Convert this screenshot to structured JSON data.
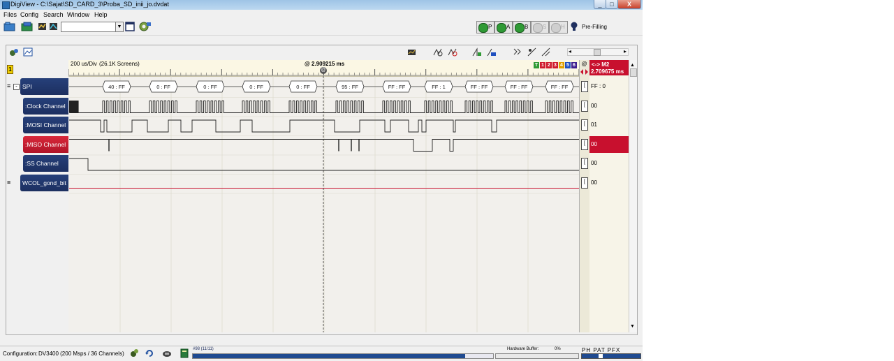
{
  "window": {
    "title": "DigiView - C:\\Sajat\\SD_CARD_3\\Proba_SD_inii_jo.dvdat",
    "min": "_",
    "max": "□",
    "close": "X"
  },
  "menu": [
    "Files",
    "Config",
    "Search",
    "Window",
    "Help"
  ],
  "toolbar": {
    "combo_value": "",
    "buttons": [
      {
        "key": "P",
        "label": "P"
      },
      {
        "key": "A",
        "label": "A"
      },
      {
        "key": "B",
        "label": "B"
      },
      {
        "key": "S",
        "label": "S"
      },
      {
        "key": "H",
        "label": "H"
      }
    ],
    "status": "Pre-Filling"
  },
  "marker_toolbar": {
    "trigger_badge": "1",
    "hscroll_left": "◂",
    "hscroll_right": "▸"
  },
  "ruler": {
    "timebase": "200 us/Div",
    "screens": "(26.1K Screens)",
    "cursor_time": "@ 2.909215 ms",
    "cursor_marker": "@",
    "legend": [
      "T",
      "1",
      "2",
      "3",
      "4",
      "5",
      "6"
    ],
    "legend_colors": [
      "#2f9a35",
      "#d01c2c",
      "#d01c2c",
      "#d01c2c",
      "#e0a000",
      "#2050c0",
      "#402090"
    ],
    "delta_label": "<-> M2",
    "delta_value": "2.709675 ms",
    "at_symbol": "@"
  },
  "channels": [
    {
      "name": "SPI",
      "expander": "≡",
      "collapse": "-",
      "value": "FF : 0",
      "highlight": false
    },
    {
      "name": ":Clock Channel",
      "value": "00",
      "highlight": false
    },
    {
      "name": ":MOSI Channel",
      "value": "01",
      "highlight": false
    },
    {
      "name": ":MISO Channel",
      "value": "00",
      "highlight": true
    },
    {
      "name": ":SS Channel",
      "value": "00",
      "highlight": false
    },
    {
      "name": "WCOL_gond_bit",
      "expander": "≡",
      "value": "00",
      "highlight": false
    }
  ],
  "spi_frames": [
    "40 : FF",
    "0 : FF",
    "0 : FF",
    "0 : FF",
    "0 : FF",
    "95 : FF",
    "FF : FF",
    "FF : 1",
    "FF : FF",
    "FF : FF",
    "FF : FF"
  ],
  "bottom": {
    "configuration_label": "Configuration:",
    "configuration_value": "DV3400 (200 Msps / 36 Channels)",
    "progress_label": "#98 (11/11)",
    "hw_buffer_label": "Hardware Buffer:",
    "hw_buffer_value": "0%",
    "hw_buffer_fraction": 0,
    "progress_fraction": 1.0,
    "flags": "PH  PAT  PFX"
  },
  "colors": {
    "accent_blue": "#1c2f60",
    "highlight_red": "#c8102e",
    "plot_bg": "#f2f0ec"
  }
}
